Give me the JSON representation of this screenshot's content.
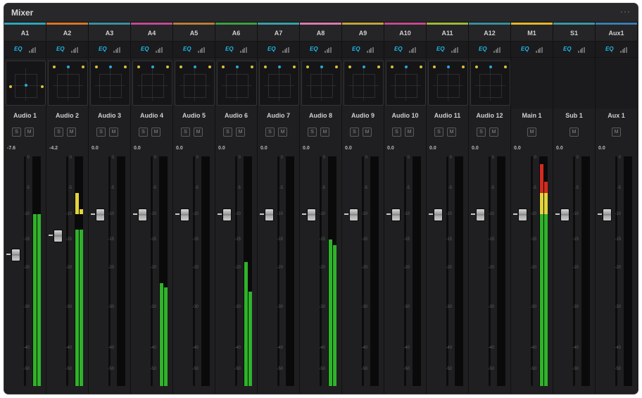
{
  "window": {
    "title": "Mixer",
    "menu_label": "···"
  },
  "ticks": [
    "0",
    "-5",
    "-10",
    "-15",
    "-20",
    "-30",
    "-40",
    "-50"
  ],
  "channels": [
    {
      "id": "A1",
      "name": "Audio 1",
      "color": "#2fa7b9",
      "pan": true,
      "buttons": [
        "S",
        "M"
      ],
      "volume": "-7.6",
      "fader_db": -7.6,
      "meter": [
        {
          "level": -10,
          "peak": -10
        },
        {
          "level": -10,
          "peak": -10
        }
      ]
    },
    {
      "id": "A2",
      "name": "Audio 2",
      "color": "#d9742b",
      "pan": true,
      "buttons": [
        "S",
        "M"
      ],
      "volume": "-4.2",
      "fader_db": -4.2,
      "meter": [
        {
          "level": -13,
          "peak": -6
        },
        {
          "level": -13,
          "peak": -9
        }
      ]
    },
    {
      "id": "A3",
      "name": "Audio 3",
      "color": "#3c8fa0",
      "pan": true,
      "buttons": [
        "S",
        "M"
      ],
      "volume": "0.0",
      "fader_db": 0.0,
      "meter": [
        {
          "level": null,
          "peak": null
        },
        {
          "level": null,
          "peak": null
        }
      ]
    },
    {
      "id": "A4",
      "name": "Audio 4",
      "color": "#c04a95",
      "pan": true,
      "buttons": [
        "S",
        "M"
      ],
      "volume": "0.0",
      "fader_db": 0.0,
      "meter": [
        {
          "level": -24,
          "peak": -24
        },
        {
          "level": -25,
          "peak": -25
        }
      ]
    },
    {
      "id": "A5",
      "name": "Audio 5",
      "color": "#b57f38",
      "pan": true,
      "buttons": [
        "S",
        "M"
      ],
      "volume": "0.0",
      "fader_db": 0.0,
      "meter": [
        {
          "level": null,
          "peak": null
        },
        {
          "level": null,
          "peak": null
        }
      ]
    },
    {
      "id": "A6",
      "name": "Audio 6",
      "color": "#3c9f45",
      "pan": true,
      "buttons": [
        "S",
        "M"
      ],
      "volume": "0.0",
      "fader_db": 0.0,
      "meter": [
        {
          "level": -19,
          "peak": -19
        },
        {
          "level": -26,
          "peak": -26
        }
      ]
    },
    {
      "id": "A7",
      "name": "Audio 7",
      "color": "#3aa0a6",
      "pan": true,
      "buttons": [
        "S",
        "M"
      ],
      "volume": "0.0",
      "fader_db": 0.0,
      "meter": [
        {
          "level": null,
          "peak": null
        },
        {
          "level": null,
          "peak": null
        }
      ]
    },
    {
      "id": "A8",
      "name": "Audio 8",
      "color": "#d97cad",
      "pan": true,
      "buttons": [
        "S",
        "M"
      ],
      "volume": "0.0",
      "fader_db": 0.0,
      "meter": [
        {
          "level": -15,
          "peak": -15
        },
        {
          "level": -16,
          "peak": -16
        }
      ]
    },
    {
      "id": "A9",
      "name": "Audio 9",
      "color": "#c2a43b",
      "pan": true,
      "buttons": [
        "S",
        "M"
      ],
      "volume": "0.0",
      "fader_db": 0.0,
      "meter": [
        {
          "level": null,
          "peak": null
        },
        {
          "level": null,
          "peak": null
        }
      ]
    },
    {
      "id": "A10",
      "name": "Audio 10",
      "color": "#c34a8f",
      "pan": true,
      "buttons": [
        "S",
        "M"
      ],
      "volume": "0.0",
      "fader_db": 0.0,
      "meter": [
        {
          "level": null,
          "peak": null
        },
        {
          "level": null,
          "peak": null
        }
      ]
    },
    {
      "id": "A11",
      "name": "Audio 11",
      "color": "#9fb83a",
      "pan": true,
      "buttons": [
        "S",
        "M"
      ],
      "volume": "0.0",
      "fader_db": 0.0,
      "meter": [
        {
          "level": null,
          "peak": null
        },
        {
          "level": null,
          "peak": null
        }
      ]
    },
    {
      "id": "A12",
      "name": "Audio 12",
      "color": "#3b8f9c",
      "pan": true,
      "buttons": [
        "S",
        "M"
      ],
      "volume": "0.0",
      "fader_db": 0.0,
      "meter": [
        {
          "level": null,
          "peak": null
        },
        {
          "level": null,
          "peak": null
        }
      ]
    },
    {
      "id": "M1",
      "name": "Main 1",
      "color": "#e6b52b",
      "pan": false,
      "buttons": [
        "M"
      ],
      "volume": "0.0",
      "fader_db": 0.0,
      "meter": [
        {
          "level": -10,
          "peak": -1
        },
        {
          "level": -10,
          "peak": -4
        }
      ]
    },
    {
      "id": "S1",
      "name": "Sub 1",
      "color": "#3c98a8",
      "pan": false,
      "buttons": [
        "M"
      ],
      "volume": "0.0",
      "fader_db": 0.0,
      "meter": [
        {
          "level": null,
          "peak": null
        },
        {
          "level": null,
          "peak": null
        }
      ]
    },
    {
      "id": "Aux1",
      "name": "Aux 1",
      "color": "#3a7fb0",
      "pan": false,
      "buttons": [
        "M"
      ],
      "volume": "0.0",
      "fader_db": 0.0,
      "meter": [
        {
          "level": null,
          "peak": null
        },
        {
          "level": null,
          "peak": null
        }
      ]
    }
  ],
  "eq_label": "EQ",
  "colors": {
    "meter_green": "#2fb32a",
    "meter_yellow": "#e3d43a",
    "meter_red": "#d42b1e",
    "eq_blue": "#1eb6e6",
    "pan_yellow": "#d9c23b",
    "pan_blue": "#2aa8d8"
  }
}
